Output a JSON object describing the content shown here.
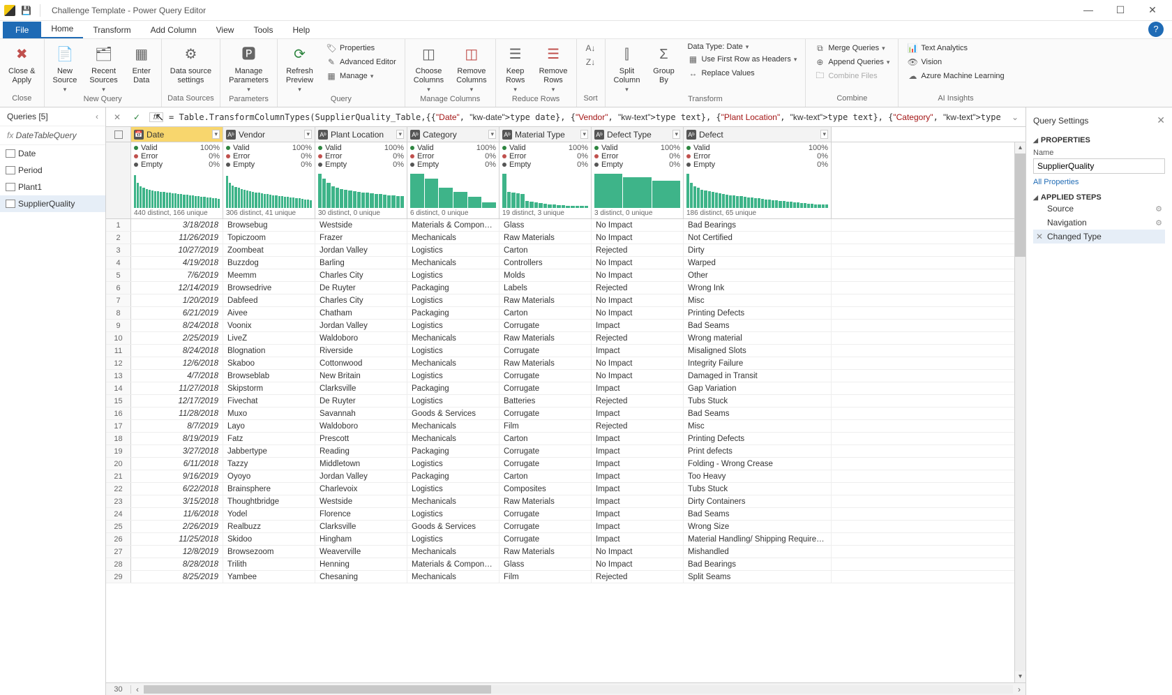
{
  "window": {
    "title": "Challenge Template - Power Query Editor"
  },
  "tabs": {
    "file": "File",
    "home": "Home",
    "transform": "Transform",
    "add": "Add Column",
    "view": "View",
    "tools": "Tools",
    "help": "Help"
  },
  "ribbon": {
    "close_apply": "Close &\nApply",
    "new_source": "New\nSource",
    "recent_sources": "Recent\nSources",
    "enter_data": "Enter\nData",
    "ds_settings": "Data source\nsettings",
    "manage_params": "Manage\nParameters",
    "refresh": "Refresh\nPreview",
    "properties": "Properties",
    "adv_editor": "Advanced Editor",
    "manage": "Manage",
    "choose_cols": "Choose\nColumns",
    "remove_cols": "Remove\nColumns",
    "keep_rows": "Keep\nRows",
    "remove_rows": "Remove\nRows",
    "sort_asc": "↧",
    "sort_desc": "↥",
    "split": "Split\nColumn",
    "group": "Group\nBy",
    "datatype": "Data Type: Date",
    "first_row": "Use First Row as Headers",
    "replace": "Replace Values",
    "merge": "Merge Queries",
    "append": "Append Queries",
    "combine_files": "Combine Files",
    "text_an": "Text Analytics",
    "vision": "Vision",
    "azure": "Azure Machine Learning",
    "g_close": "Close",
    "g_newq": "New Query",
    "g_ds": "Data Sources",
    "g_params": "Parameters",
    "g_query": "Query",
    "g_mcols": "Manage Columns",
    "g_rrows": "Reduce Rows",
    "g_sort": "Sort",
    "g_trans": "Transform",
    "g_comb": "Combine",
    "g_ai": "AI Insights"
  },
  "queries": {
    "header": "Queries [5]",
    "fx": "DateTableQuery",
    "items": [
      "Date",
      "Period",
      "Plant1",
      "SupplierQuality"
    ],
    "selected": 3
  },
  "formula": "= Table.TransformColumnTypes(SupplierQuality_Table,{{\"Date\", type date}, {\"Vendor\", type text}, {\"Plant Location\", type text}, {\"Category\", type text}, {\"Material",
  "columns": [
    {
      "name": "Date",
      "type": "📅",
      "valid": "100%",
      "err": "0%",
      "empty": "0%",
      "dist": "440 distinct, 166 unique",
      "w": "col-date",
      "sel": true,
      "heights": [
        90,
        70,
        60,
        55,
        52,
        50,
        48,
        47,
        46,
        45,
        44,
        43,
        42,
        41,
        40,
        39,
        38,
        37,
        36,
        35,
        34,
        33,
        32,
        31,
        30,
        29,
        28,
        27,
        26,
        25
      ]
    },
    {
      "name": "Vendor",
      "type": "AᵇC",
      "valid": "100%",
      "err": "0%",
      "empty": "0%",
      "dist": "306 distinct, 41 unique",
      "w": "col-vend",
      "heights": [
        88,
        70,
        62,
        58,
        55,
        52,
        50,
        48,
        46,
        45,
        43,
        42,
        40,
        39,
        38,
        36,
        35,
        34,
        33,
        32,
        31,
        30,
        29,
        28,
        27,
        26,
        25,
        24,
        23,
        22
      ]
    },
    {
      "name": "Plant Location",
      "type": "AᵇC",
      "valid": "100%",
      "err": "0%",
      "empty": "0%",
      "dist": "30 distinct, 0 unique",
      "w": "col-plant",
      "heights": [
        95,
        80,
        70,
        60,
        55,
        52,
        50,
        48,
        46,
        45,
        43,
        42,
        40,
        39,
        38,
        36,
        35,
        34,
        33,
        32
      ]
    },
    {
      "name": "Category",
      "type": "AᵇC",
      "valid": "100%",
      "err": "0%",
      "empty": "0%",
      "dist": "6 distinct, 0 unique",
      "w": "col-cat",
      "heights": [
        95,
        80,
        55,
        45,
        30,
        15
      ]
    },
    {
      "name": "Material Type",
      "type": "AᵇC",
      "valid": "100%",
      "err": "0%",
      "empty": "0%",
      "dist": "19 distinct, 3 unique",
      "w": "col-mat",
      "heights": [
        95,
        45,
        42,
        40,
        38,
        20,
        18,
        16,
        14,
        12,
        10,
        9,
        8,
        7,
        6,
        5,
        5,
        5,
        5
      ]
    },
    {
      "name": "Defect Type",
      "type": "AᵇC",
      "valid": "100%",
      "err": "0%",
      "empty": "0%",
      "dist": "3 distinct, 0 unique",
      "w": "col-dtype",
      "heights": [
        95,
        85,
        75
      ]
    },
    {
      "name": "Defect",
      "type": "AᵇC",
      "valid": "100%",
      "err": "0%",
      "empty": "0%",
      "dist": "186 distinct, 65 unique",
      "w": "col-def",
      "heights": [
        95,
        70,
        60,
        55,
        50,
        48,
        46,
        44,
        42,
        40,
        38,
        36,
        35,
        34,
        33,
        32,
        30,
        29,
        28,
        27,
        26,
        25,
        24,
        23,
        22,
        21,
        20,
        19,
        18,
        17,
        16,
        15,
        14,
        13,
        12,
        11,
        10,
        10,
        10,
        10
      ]
    }
  ],
  "rows": [
    [
      "3/18/2018",
      "Browsebug",
      "Westside",
      "Materials & Components",
      "Glass",
      "No Impact",
      "Bad Bearings"
    ],
    [
      "11/26/2019",
      "Topiczoom",
      "Frazer",
      "Mechanicals",
      "Raw Materials",
      "No Impact",
      "Not Certified"
    ],
    [
      "10/27/2019",
      "Zoombeat",
      "Jordan Valley",
      "Logistics",
      "Carton",
      "Rejected",
      "Dirty"
    ],
    [
      "4/19/2018",
      "Buzzdog",
      "Barling",
      "Mechanicals",
      "Controllers",
      "No Impact",
      "Warped"
    ],
    [
      "7/6/2019",
      "Meemm",
      "Charles City",
      "Logistics",
      "Molds",
      "No Impact",
      "Other"
    ],
    [
      "12/14/2019",
      "Browsedrive",
      "De Ruyter",
      "Packaging",
      "Labels",
      "Rejected",
      "Wrong Ink"
    ],
    [
      "1/20/2019",
      "Dabfeed",
      "Charles City",
      "Logistics",
      "Raw Materials",
      "No Impact",
      "Misc"
    ],
    [
      "6/21/2019",
      "Aivee",
      "Chatham",
      "Packaging",
      "Carton",
      "No Impact",
      "Printing Defects"
    ],
    [
      "8/24/2018",
      "Voonix",
      "Jordan Valley",
      "Logistics",
      "Corrugate",
      "Impact",
      "Bad Seams"
    ],
    [
      "2/25/2019",
      "LiveZ",
      "Waldoboro",
      "Mechanicals",
      "Raw Materials",
      "Rejected",
      "Wrong material"
    ],
    [
      "8/24/2018",
      "Blognation",
      "Riverside",
      "Logistics",
      "Corrugate",
      "Impact",
      "Misaligned Slots"
    ],
    [
      "12/6/2018",
      "Skaboo",
      "Cottonwood",
      "Mechanicals",
      "Raw Materials",
      "No Impact",
      "Integrity Failure"
    ],
    [
      "4/7/2018",
      "Browseblab",
      "New Britain",
      "Logistics",
      "Corrugate",
      "No Impact",
      "Damaged in Transit"
    ],
    [
      "11/27/2018",
      "Skipstorm",
      "Clarksville",
      "Packaging",
      "Corrugate",
      "Impact",
      "Gap Variation"
    ],
    [
      "12/17/2019",
      "Fivechat",
      "De Ruyter",
      "Logistics",
      "Batteries",
      "Rejected",
      "Tubs Stuck"
    ],
    [
      "11/28/2018",
      "Muxo",
      "Savannah",
      "Goods & Services",
      "Corrugate",
      "Impact",
      "Bad Seams"
    ],
    [
      "8/7/2019",
      "Layo",
      "Waldoboro",
      "Mechanicals",
      "Film",
      "Rejected",
      "Misc"
    ],
    [
      "8/19/2019",
      "Fatz",
      "Prescott",
      "Mechanicals",
      "Carton",
      "Impact",
      "Printing Defects"
    ],
    [
      "3/27/2018",
      "Jabbertype",
      "Reading",
      "Packaging",
      "Corrugate",
      "Impact",
      "Print defects"
    ],
    [
      "6/11/2018",
      "Tazzy",
      "Middletown",
      "Logistics",
      "Corrugate",
      "Impact",
      "Folding - Wrong Crease"
    ],
    [
      "9/16/2019",
      "Oyoyo",
      "Jordan Valley",
      "Packaging",
      "Carton",
      "Impact",
      "Too Heavy"
    ],
    [
      "6/22/2018",
      "Brainsphere",
      "Charlevoix",
      "Logistics",
      "Composites",
      "Impact",
      "Tubs Stuck"
    ],
    [
      "3/15/2018",
      "Thoughtbridge",
      "Westside",
      "Mechanicals",
      "Raw Materials",
      "Impact",
      "Dirty Containers"
    ],
    [
      "11/6/2018",
      "Yodel",
      "Florence",
      "Logistics",
      "Corrugate",
      "Impact",
      "Bad Seams"
    ],
    [
      "2/26/2019",
      "Realbuzz",
      "Clarksville",
      "Goods & Services",
      "Corrugate",
      "Impact",
      "Wrong  Size"
    ],
    [
      "11/25/2018",
      "Skidoo",
      "Hingham",
      "Logistics",
      "Corrugate",
      "Impact",
      "Material Handling/ Shipping Requirements Error"
    ],
    [
      "12/8/2019",
      "Browsezoom",
      "Weaverville",
      "Mechanicals",
      "Raw Materials",
      "No Impact",
      "Mishandled"
    ],
    [
      "8/28/2018",
      "Trilith",
      "Henning",
      "Materials & Components",
      "Glass",
      "No Impact",
      "Bad Bearings"
    ],
    [
      "8/25/2019",
      "Yambee",
      "Chesaning",
      "Mechanicals",
      "Film",
      "Rejected",
      "Split Seams"
    ]
  ],
  "next_row": "30",
  "settings": {
    "title": "Query Settings",
    "prop": "PROPERTIES",
    "name_lbl": "Name",
    "name_val": "SupplierQuality",
    "all_prop": "All Properties",
    "steps": "APPLIED STEPS",
    "step_items": [
      {
        "label": "Source",
        "gear": true
      },
      {
        "label": "Navigation",
        "gear": true
      },
      {
        "label": "Changed Type",
        "gear": false,
        "sel": true,
        "x": true
      }
    ]
  },
  "profile_labels": {
    "valid": "Valid",
    "error": "Error",
    "empty": "Empty"
  }
}
